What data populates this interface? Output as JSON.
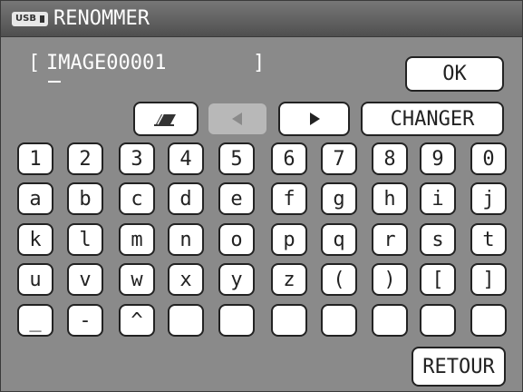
{
  "window": {
    "title": "RENOMMER",
    "badge": "USB"
  },
  "filename": {
    "open": "[",
    "value": "IMAGE00001",
    "close": "]"
  },
  "buttons": {
    "ok": "OK",
    "changer": "CHANGER",
    "retour": "RETOUR"
  },
  "tool_icons": [
    "eraser-icon",
    "arrow-left-icon",
    "arrow-right-icon"
  ],
  "keys": [
    [
      "1",
      "2",
      "3",
      "4",
      "5",
      "6",
      "7",
      "8",
      "9",
      "0"
    ],
    [
      "a",
      "b",
      "c",
      "d",
      "e",
      "f",
      "g",
      "h",
      "i",
      "j"
    ],
    [
      "k",
      "l",
      "m",
      "n",
      "o",
      "p",
      "q",
      "r",
      "s",
      "t"
    ],
    [
      "u",
      "v",
      "w",
      "x",
      "y",
      "z",
      "(",
      ")",
      "[",
      "]"
    ],
    [
      "_",
      "-",
      "^",
      "",
      "",
      "",
      "",
      "",
      "",
      ""
    ]
  ]
}
